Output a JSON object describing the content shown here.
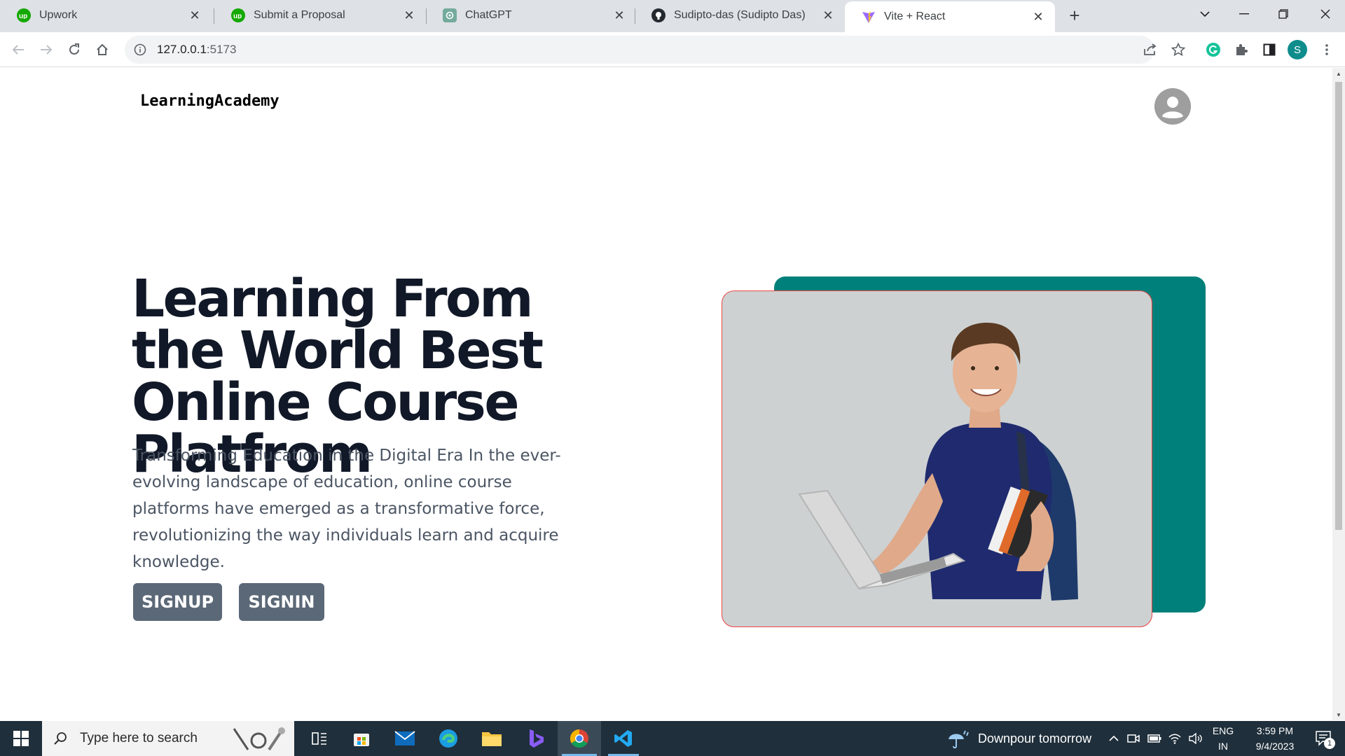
{
  "browser": {
    "tabs": [
      {
        "title": "Upwork",
        "icon": "upwork-icon",
        "active": false
      },
      {
        "title": "Submit a Proposal",
        "icon": "upwork-icon",
        "active": false
      },
      {
        "title": "ChatGPT",
        "icon": "chatgpt-icon",
        "active": false
      },
      {
        "title": "Sudipto-das (Sudipto Das)",
        "icon": "github-icon",
        "active": false
      },
      {
        "title": "Vite + React",
        "icon": "vite-icon",
        "active": true
      }
    ],
    "url_host": "127.0.0.1",
    "url_port": ":5173",
    "profile_initial": "S",
    "colors": {
      "upwork": "#14a800",
      "chatgpt": "#74aa9c",
      "profile": "#0f8c8c",
      "grammarly": "#15c39a"
    }
  },
  "page": {
    "brand": "LearningAcademy",
    "hero": {
      "title": "Learning From the World Best Online Course Platfrom",
      "description": "Transforming Education in the Digital Era In the ever-evolving landscape of education, online course platforms have emerged as a transformative force, revolutionizing the way individuals learn and acquire knowledge.",
      "signup_label": "SIGNUP",
      "signin_label": "SIGNIN"
    },
    "colors": {
      "teal": "#00807a",
      "button": "#5b6877",
      "title": "#111827",
      "card_border": "#ef4444"
    }
  },
  "taskbar": {
    "search_placeholder": "Type here to search",
    "weather": "Downpour tomorrow",
    "language": "ENG",
    "region": "IN",
    "time": "3:59 PM",
    "date": "9/4/2023",
    "notification_count": "1"
  }
}
